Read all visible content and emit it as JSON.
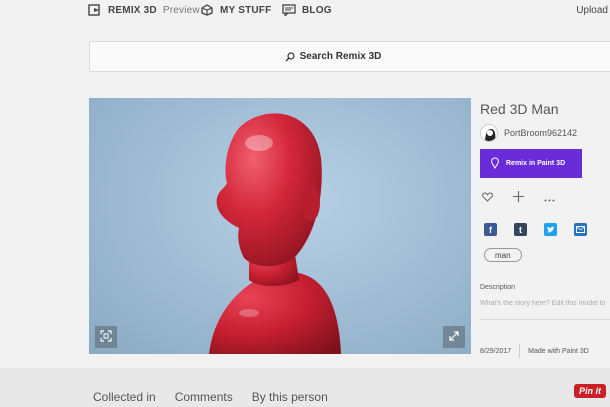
{
  "nav": {
    "remix_label": "REMIX 3D",
    "remix_sub": "Preview",
    "mystuff_label": "MY STUFF",
    "blog_label": "BLOG",
    "upload_label": "Upload"
  },
  "search": {
    "label": "Search Remix 3D"
  },
  "model": {
    "title": "Red 3D Man",
    "author": "PortBroom962142",
    "remix_button": "Remix in Paint 3D",
    "tag": "man",
    "description_label": "Description",
    "description_placeholder": "What's the story here? Edit this model to",
    "date": "8/29/2017",
    "made_with": "Made with Paint 3D"
  },
  "icons": {
    "like": "heart-icon",
    "add": "plus-icon",
    "more": "ellipsis-icon",
    "share": [
      "facebook-icon",
      "tumblr-icon",
      "twitter-icon",
      "email-icon"
    ]
  },
  "tabs": [
    "Collected in",
    "Comments",
    "By this person"
  ],
  "pin_label": "Pin it",
  "colors": {
    "accent": "#6a2cd8",
    "figure": "#d3273a",
    "pinterest": "#cb2027"
  }
}
